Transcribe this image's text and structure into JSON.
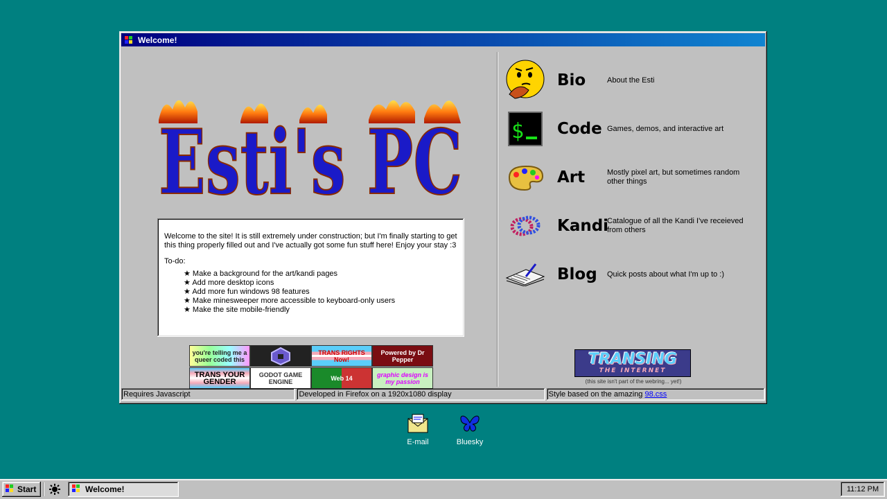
{
  "window": {
    "title": "Welcome!",
    "logo_text": "Esti's PC",
    "welcome": {
      "intro": "Welcome to the site! It is still extremely under construction; but I'm finally starting to get this thing properly filled out and I've actually got some fun stuff here! Enjoy your stay :3",
      "todo_heading": "To-do:",
      "todo_items": [
        "Make a background for the art/kandi pages",
        "Add more desktop icons",
        "Add more fun windows 98 features",
        "Make minesweeper more accessible to keyboard-only users",
        "Make the site mobile-friendly"
      ]
    },
    "badges": [
      {
        "text": "you're telling me a queer coded this"
      },
      {
        "text": "GameCube"
      },
      {
        "text": "TRANS RIGHTS Now!"
      },
      {
        "text": "Powered by Dr Pepper"
      },
      {
        "text": "TRANS YOUR GENDER"
      },
      {
        "text": "GODOT GAME ENGINE"
      },
      {
        "text": "Web 14"
      },
      {
        "text": "graphic design is my passion"
      }
    ],
    "nav": [
      {
        "label": "Bio",
        "desc": "About the Esti",
        "icon": "thinking-face-icon"
      },
      {
        "label": "Code",
        "desc": "Games, demos, and interactive art",
        "icon": "terminal-icon"
      },
      {
        "label": "Art",
        "desc": "Mostly pixel art, but sometimes random other things",
        "icon": "paint-palette-icon"
      },
      {
        "label": "Kandi",
        "desc": "Catalogue of all the Kandi I've receieved from others",
        "icon": "kandi-bracelet-icon"
      },
      {
        "label": "Blog",
        "desc": "Quick posts about what I'm up to :)",
        "icon": "open-book-icon"
      }
    ],
    "transing": {
      "title": "TRANSING",
      "subtitle": "THE INTERNET",
      "note": "(this site isn't part of the webring... yet!)"
    },
    "status": {
      "js": "Requires Javascript",
      "dev": "Developed in Firefox on a 1920x1080 display",
      "style_prefix": "Style based on the amazing",
      "style_link": "98.css"
    }
  },
  "desktop_icons": [
    {
      "label": "E-mail",
      "icon": "email-icon"
    },
    {
      "label": "Bluesky",
      "icon": "butterfly-icon"
    }
  ],
  "taskbar": {
    "start": "Start",
    "task": "Welcome!",
    "clock": "11:12 PM"
  },
  "colors": {
    "desktop": "#008080",
    "title_start": "#000080",
    "title_end": "#1084d0",
    "logo_fill": "#1a1ac8"
  }
}
